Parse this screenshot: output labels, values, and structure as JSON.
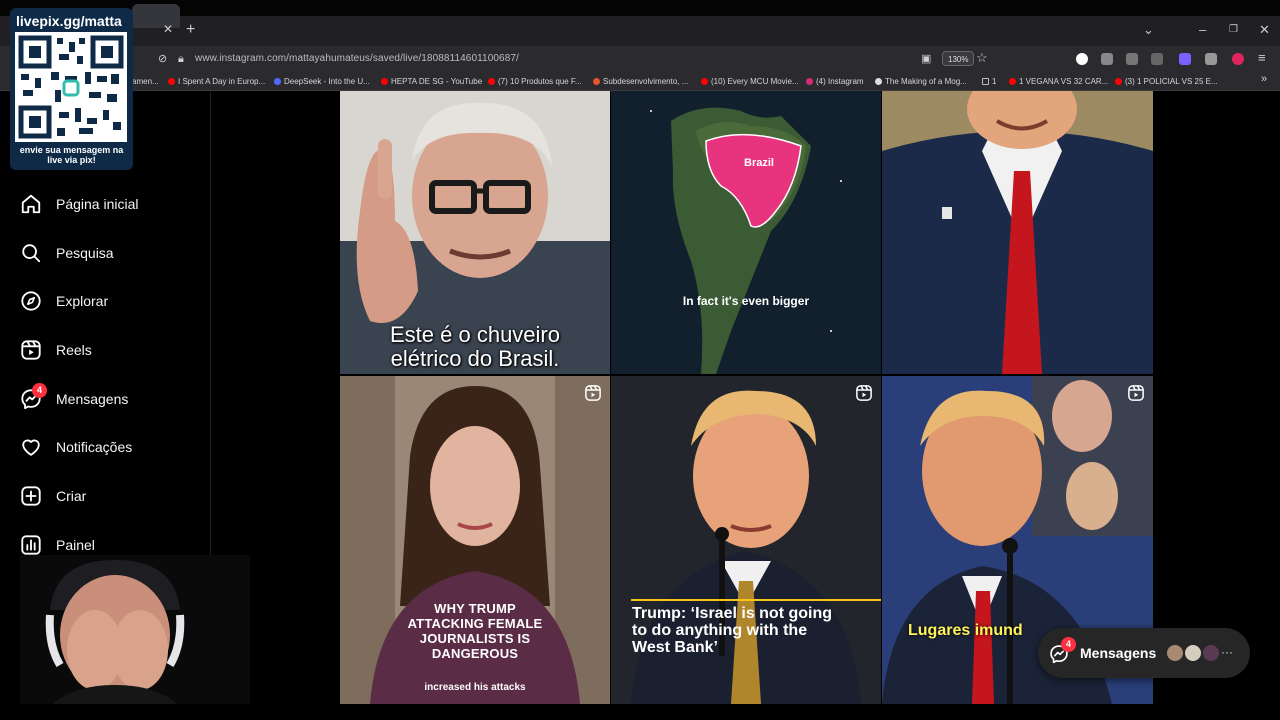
{
  "overlay": {
    "qr_title": "livepix.gg/matta",
    "qr_caption": "envie sua mensagem na live via pix!"
  },
  "browser": {
    "url": "www.instagram.com/mattayahumateus/saved/live/18088114601100687/",
    "zoom": "130%",
    "bookmarks": [
      {
        "label": "amen...",
        "color": "#e0245e"
      },
      {
        "label": "I Spent A Day in Europ...",
        "color": "#ff0000"
      },
      {
        "label": "DeepSeek - Into the U...",
        "color": "#4d6bfe"
      },
      {
        "label": "HEPTA DE SG - YouTube",
        "color": "#ff0000"
      },
      {
        "label": "(7) 10 Produtos que F...",
        "color": "#ff0000"
      },
      {
        "label": "Subdesenvolvimento, ...",
        "color": "#e8552b"
      },
      {
        "label": "(10) Every MCU Movie...",
        "color": "#ff0000"
      },
      {
        "label": "(4) Instagram",
        "color": "#d62976"
      },
      {
        "label": "The Making of a Mog...",
        "color": "#dddddd"
      },
      {
        "label": "1",
        "color": "#bbbbbb"
      },
      {
        "label": "1 VEGANA VS 32 CAR...",
        "color": "#ff0000"
      },
      {
        "label": "(3) 1 POLICIAL VS 25 E...",
        "color": "#ff0000"
      }
    ]
  },
  "sidenav": {
    "items": [
      {
        "label": "Página inicial",
        "icon": "home-icon"
      },
      {
        "label": "Pesquisa",
        "icon": "search-icon"
      },
      {
        "label": "Explorar",
        "icon": "compass-icon"
      },
      {
        "label": "Reels",
        "icon": "reels-icon"
      },
      {
        "label": "Mensagens",
        "icon": "messenger-icon",
        "badge": "4"
      },
      {
        "label": "Notificações",
        "icon": "heart-icon"
      },
      {
        "label": "Criar",
        "icon": "plus-square-icon"
      },
      {
        "label": "Painel",
        "icon": "chart-icon"
      }
    ]
  },
  "posts": [
    {
      "caption": "Este é o chuveiro elétrico do Brasil.",
      "line1": "Este é o chuveiro",
      "line2": "elétrico do Brasil."
    },
    {
      "map_label": "Brazil",
      "caption": "In fact it's even bigger"
    },
    {
      "caption": ""
    },
    {
      "headline1": "WHY TRUMP",
      "headline2": "ATTACKING FEMALE",
      "headline3": "JOURNALISTS IS",
      "headline4": "DANGEROUS",
      "subtitle": "increased his attacks"
    },
    {
      "line1": "Trump: ‘Israel is not going",
      "line2": "to do anything with the",
      "line3": "West Bank’"
    },
    {
      "caption": "Lugares imund"
    }
  ],
  "messages_pill": {
    "label": "Mensagens",
    "badge": "4",
    "more": "···"
  }
}
